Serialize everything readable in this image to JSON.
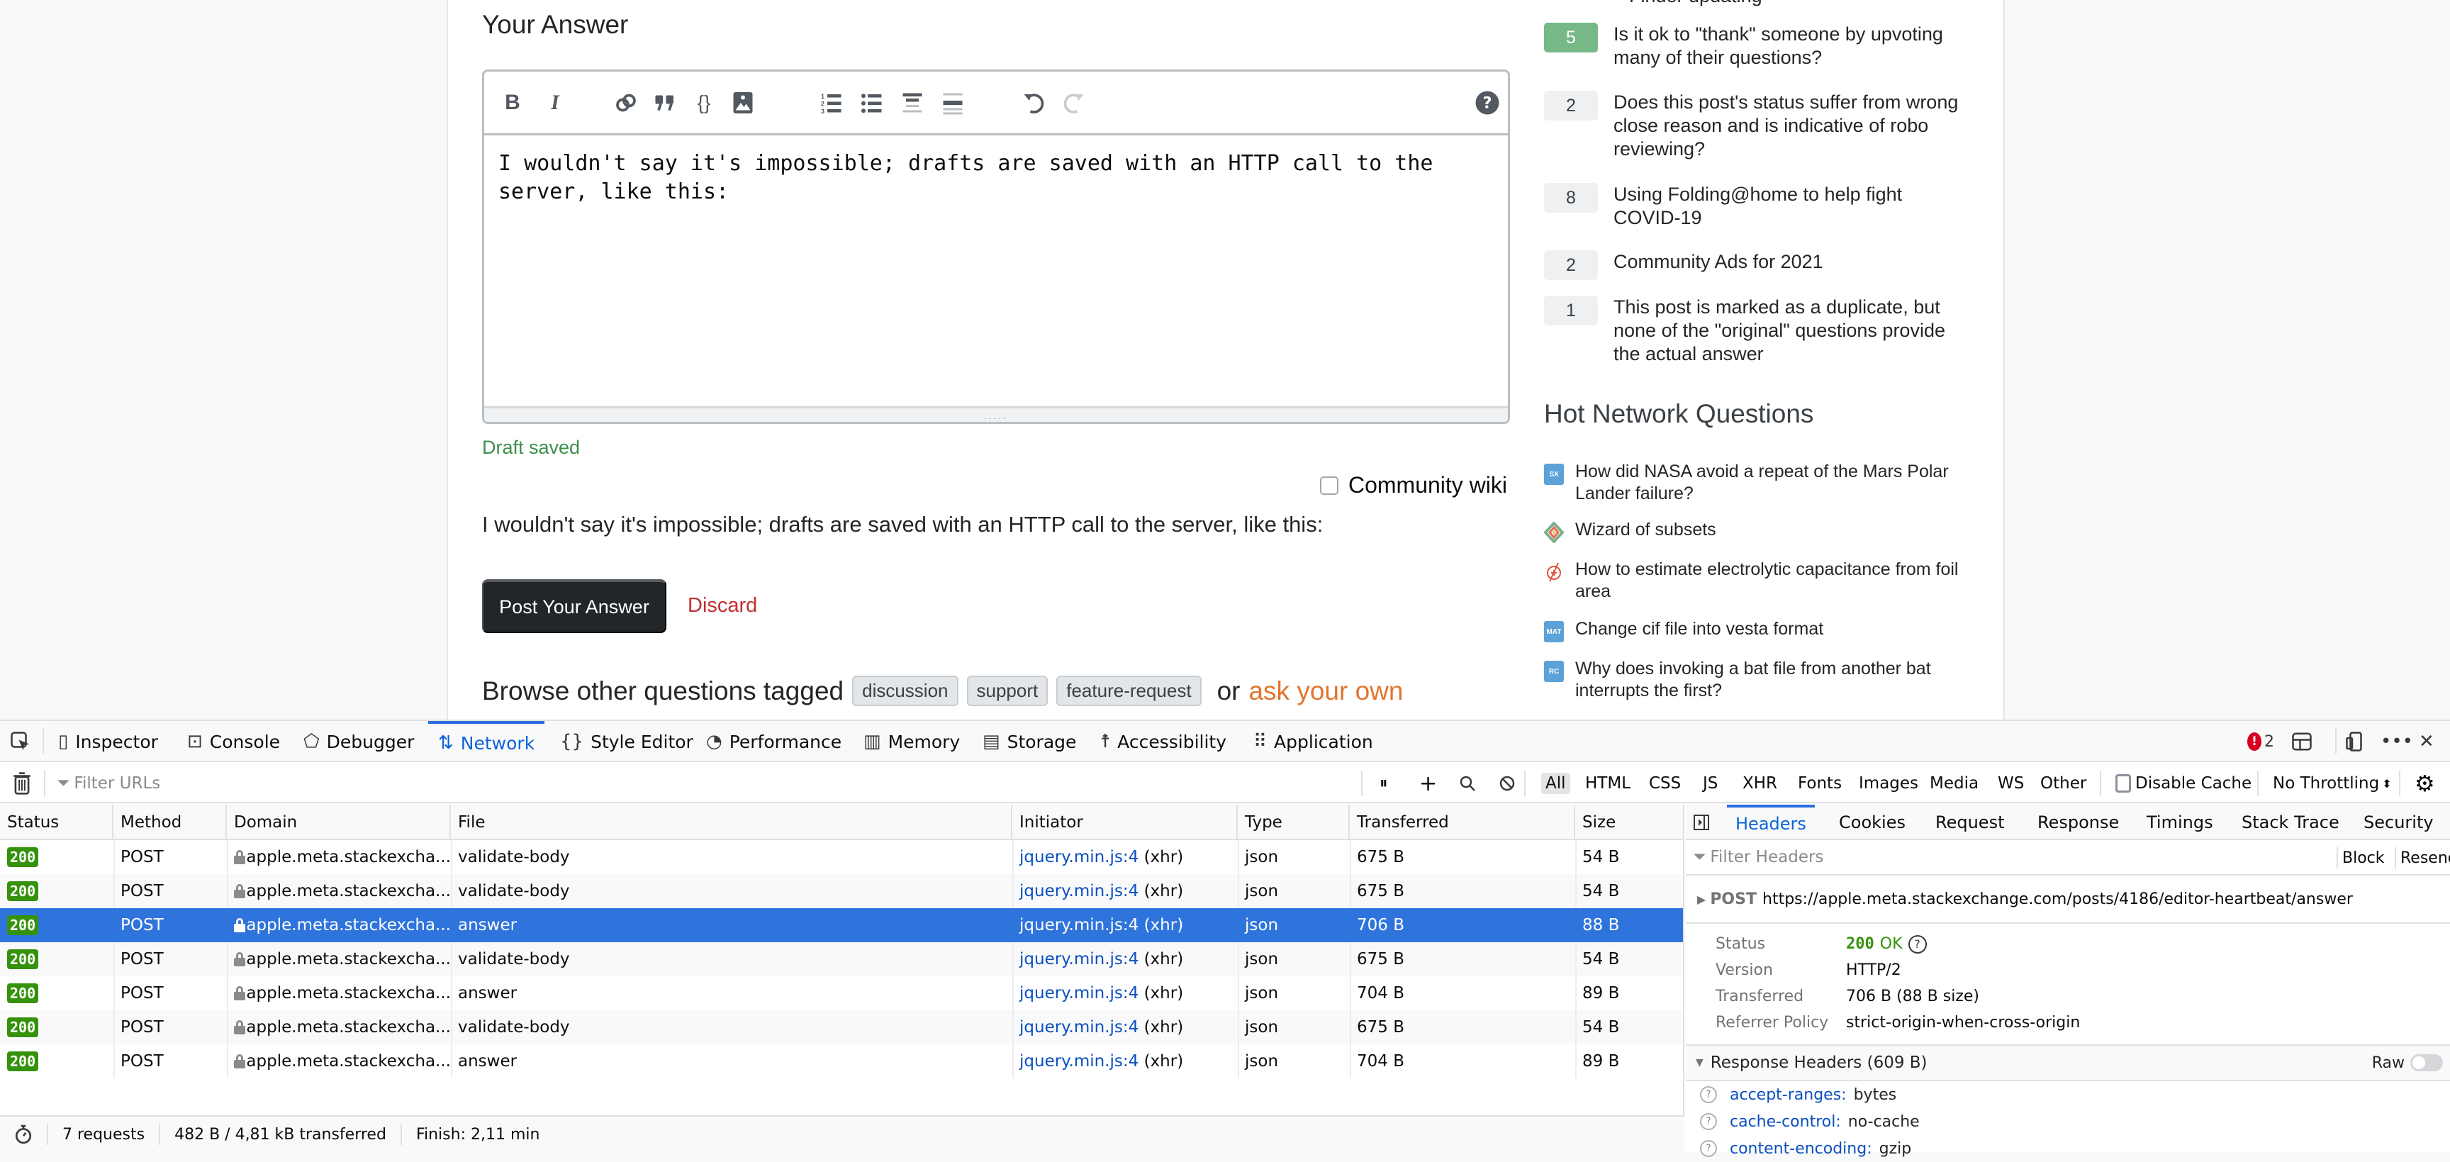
{
  "page": {
    "heading": "Your Answer",
    "editor": {
      "toolbar": {
        "bold": "B",
        "italic": "I",
        "help": "?"
      },
      "text": "I wouldn't say it's impossible; drafts are saved with an HTTP call to the server, like this:",
      "grip": "....."
    },
    "draft_status": "Draft saved",
    "community_wiki_label": "Community wiki",
    "preview_text": "I wouldn't say it's impossible; drafts are saved with an HTTP call to the server, like this:",
    "post_button": "Post Your Answer",
    "discard_link": "Discard",
    "browse": {
      "prefix": "Browse other questions tagged",
      "tags": [
        "discussion",
        "support",
        "feature-request"
      ],
      "or": "or",
      "ask_link": "ask your own"
    }
  },
  "sidebar": {
    "partial_top_item": "Finder updating",
    "meta_items": [
      {
        "score": "5",
        "accepted": true,
        "title": "Is it ok to \"thank\" someone by upvoting many of their questions?"
      },
      {
        "score": "2",
        "accepted": false,
        "title": "Does this post's status suffer from wrong close reason and is indicative of robo reviewing?"
      },
      {
        "score": "8",
        "accepted": false,
        "title": "Using Folding@home to help fight COVID-19"
      },
      {
        "score": "2",
        "accepted": false,
        "title": "Community Ads for 2021"
      },
      {
        "score": "1",
        "accepted": false,
        "title": "This post is marked as a duplicate, but none of the \"original\" questions provide the actual answer"
      }
    ],
    "hot_network_title": "Hot Network Questions",
    "hot_network": [
      {
        "site_icon": "SX",
        "title": "How did NASA avoid a repeat of the Mars Polar Lander failure?"
      },
      {
        "site_icon": "codegolf",
        "title": "Wizard of subsets"
      },
      {
        "site_icon": "electronics",
        "title": "How to estimate electrolytic capacitance from foil area"
      },
      {
        "site_icon": "MAT",
        "title": "Change cif file into vesta format"
      },
      {
        "site_icon": "RC",
        "title": "Why does invoking a bat file from another bat interrupts the first?"
      }
    ]
  },
  "devtools": {
    "tabs": [
      {
        "label": "Inspector",
        "icon": "inspector-icon"
      },
      {
        "label": "Console",
        "icon": "console-icon"
      },
      {
        "label": "Debugger",
        "icon": "debugger-icon"
      },
      {
        "label": "Network",
        "icon": "network-icon",
        "active": true
      },
      {
        "label": "Style Editor",
        "icon": "style-editor-icon"
      },
      {
        "label": "Performance",
        "icon": "performance-icon"
      },
      {
        "label": "Memory",
        "icon": "memory-icon"
      },
      {
        "label": "Storage",
        "icon": "storage-icon"
      },
      {
        "label": "Accessibility",
        "icon": "accessibility-icon"
      },
      {
        "label": "Application",
        "icon": "application-icon"
      }
    ],
    "error_count": "2",
    "filter_placeholder": "Filter URLs",
    "type_filters": [
      "All",
      "HTML",
      "CSS",
      "JS",
      "XHR",
      "Fonts",
      "Images",
      "Media",
      "WS",
      "Other"
    ],
    "active_type_filter": "All",
    "disable_cache_label": "Disable Cache",
    "throttling": "No Throttling",
    "columns": [
      "Status",
      "Method",
      "Domain",
      "File",
      "Initiator",
      "Type",
      "Transferred",
      "Size"
    ],
    "requests": [
      {
        "status": "200",
        "method": "POST",
        "domain": "apple.meta.stackexcha...",
        "file": "validate-body",
        "initiator_link": "jquery.min.js:4",
        "initiator_type": "(xhr)",
        "type": "json",
        "transferred": "675 B",
        "size": "54 B"
      },
      {
        "status": "200",
        "method": "POST",
        "domain": "apple.meta.stackexcha...",
        "file": "validate-body",
        "initiator_link": "jquery.min.js:4",
        "initiator_type": "(xhr)",
        "type": "json",
        "transferred": "675 B",
        "size": "54 B"
      },
      {
        "status": "200",
        "method": "POST",
        "domain": "apple.meta.stackexcha...",
        "file": "answer",
        "initiator_link": "jquery.min.js:4",
        "initiator_type": "(xhr)",
        "type": "json",
        "transferred": "706 B",
        "size": "88 B",
        "selected": true
      },
      {
        "status": "200",
        "method": "POST",
        "domain": "apple.meta.stackexcha...",
        "file": "validate-body",
        "initiator_link": "jquery.min.js:4",
        "initiator_type": "(xhr)",
        "type": "json",
        "transferred": "675 B",
        "size": "54 B"
      },
      {
        "status": "200",
        "method": "POST",
        "domain": "apple.meta.stackexcha...",
        "file": "answer",
        "initiator_link": "jquery.min.js:4",
        "initiator_type": "(xhr)",
        "type": "json",
        "transferred": "704 B",
        "size": "89 B"
      },
      {
        "status": "200",
        "method": "POST",
        "domain": "apple.meta.stackexcha...",
        "file": "validate-body",
        "initiator_link": "jquery.min.js:4",
        "initiator_type": "(xhr)",
        "type": "json",
        "transferred": "675 B",
        "size": "54 B"
      },
      {
        "status": "200",
        "method": "POST",
        "domain": "apple.meta.stackexcha...",
        "file": "answer",
        "initiator_link": "jquery.min.js:4",
        "initiator_type": "(xhr)",
        "type": "json",
        "transferred": "704 B",
        "size": "89 B"
      }
    ],
    "footer": {
      "requests": "7 requests",
      "transferred": "482 B / 4,81 kB transferred",
      "finish": "Finish: 2,11 min"
    },
    "details": {
      "tabs": [
        "Headers",
        "Cookies",
        "Request",
        "Response",
        "Timings",
        "Stack Trace",
        "Security"
      ],
      "active_tab": "Headers",
      "filter_placeholder": "Filter Headers",
      "block_label": "Block",
      "resend_label": "Resend",
      "method": "POST",
      "url": "https://apple.meta.stackexchange.com/posts/4186/editor-heartbeat/answer",
      "summary": [
        {
          "key": "Status",
          "code": "200",
          "text": "OK"
        },
        {
          "key": "Version",
          "value": "HTTP/2"
        },
        {
          "key": "Transferred",
          "value": "706 B (88 B size)"
        },
        {
          "key": "Referrer Policy",
          "value": "strict-origin-when-cross-origin"
        }
      ],
      "response_headers_title": "Response Headers (609 B)",
      "raw_label": "Raw",
      "response_headers": [
        {
          "name": "accept-ranges:",
          "value": "bytes"
        },
        {
          "name": "cache-control:",
          "value": "no-cache"
        },
        {
          "name": "content-encoding:",
          "value": "gzip"
        }
      ]
    }
  }
}
